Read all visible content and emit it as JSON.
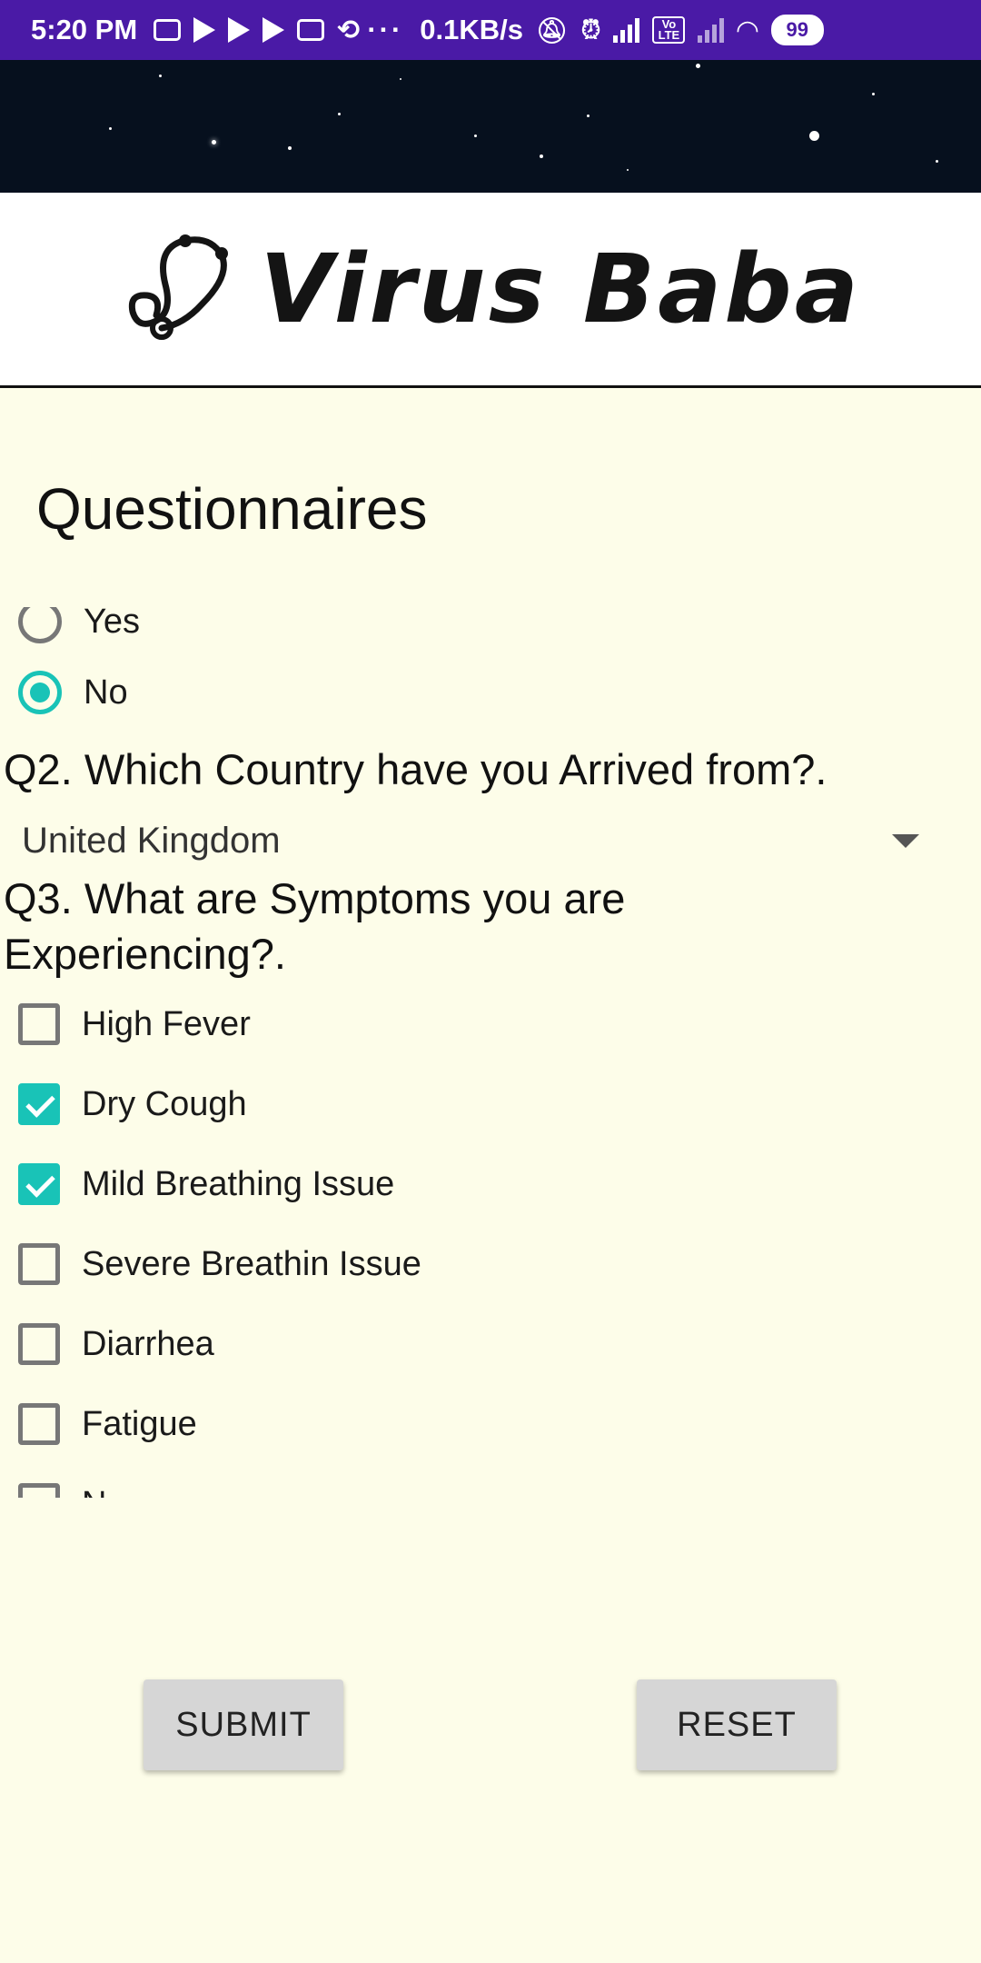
{
  "status_bar": {
    "time": "5:20 PM",
    "network_speed": "0.1KB/s",
    "more": "···",
    "volte": "Vo LTE",
    "battery": "99"
  },
  "header": {
    "logo_text": "Virus Baba"
  },
  "page": {
    "title": "Questionnaires"
  },
  "q1": {
    "options": [
      {
        "label": "Yes",
        "selected": false
      },
      {
        "label": "No",
        "selected": true
      }
    ]
  },
  "q2": {
    "text": "Q2. Which Country have you Arrived from?.",
    "selected": "United Kingdom"
  },
  "q3": {
    "text_line1": "Q3. What are Symptoms you are",
    "text_line2": "Experiencing?.",
    "options": [
      {
        "label": "High Fever",
        "checked": false
      },
      {
        "label": "Dry Cough",
        "checked": true
      },
      {
        "label": "Mild Breathing Issue",
        "checked": true
      },
      {
        "label": "Severe Breathin Issue",
        "checked": false
      },
      {
        "label": "Diarrhea",
        "checked": false
      },
      {
        "label": "Fatigue",
        "checked": false
      },
      {
        "label": "N",
        "checked": false
      }
    ]
  },
  "actions": {
    "submit_label": "SUBMIT",
    "reset_label": "RESET"
  },
  "colors": {
    "accent": "#19c3b7",
    "status_bar": "#4a1aa6",
    "background": "#fdfde9"
  }
}
